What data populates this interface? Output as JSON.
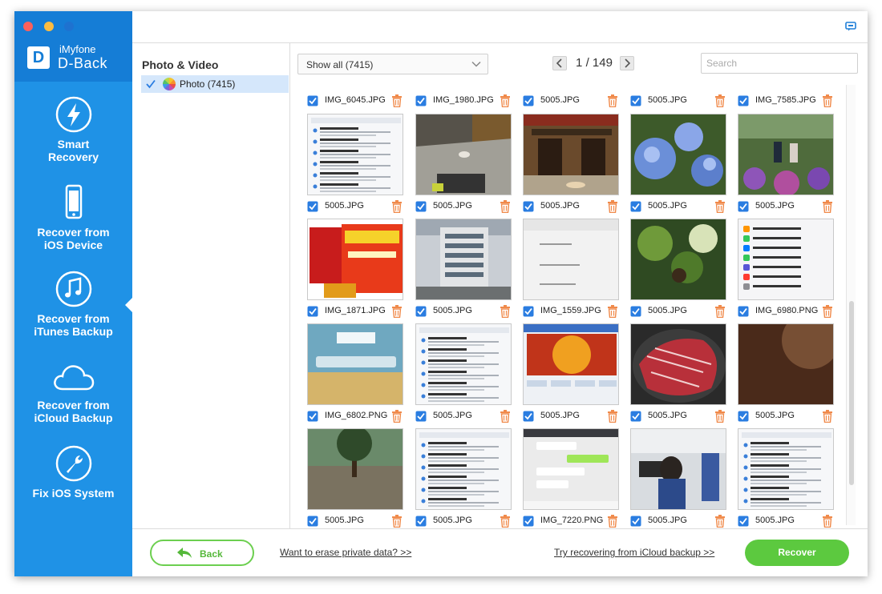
{
  "app": {
    "brand_small": "iMyfone",
    "brand_large": "D-Back",
    "logo_letter": "D"
  },
  "sidebar": {
    "items": [
      {
        "label_line1": "Smart",
        "label_line2": "Recovery",
        "icon": "lightning-icon"
      },
      {
        "label_line1": "Recover from",
        "label_line2": "iOS Device",
        "icon": "phone-icon"
      },
      {
        "label_line1": "Recover from",
        "label_line2": "iTunes Backup",
        "icon": "music-note-icon"
      },
      {
        "label_line1": "Recover from",
        "label_line2": "iCloud Backup",
        "icon": "cloud-icon"
      },
      {
        "label_line1": "Fix iOS System",
        "label_line2": "",
        "icon": "wrench-icon"
      }
    ],
    "active_index": 2
  },
  "category": {
    "title": "Photo & Video",
    "items": [
      {
        "label": "Photo (7415)",
        "checked": true
      }
    ]
  },
  "toolbar": {
    "filter_value": "Show all (7415)",
    "page_current": "1",
    "page_separator": "/",
    "page_total": "149",
    "search_placeholder": "Search"
  },
  "gallery": {
    "partial_row": [
      "IMG_6045.JPG",
      "IMG_1980.JPG",
      "5005.JPG",
      "5005.JPG",
      "IMG_7585.JPG"
    ],
    "rows": [
      [
        {
          "name": "5005.JPG",
          "thumb": "screenshot-list"
        },
        {
          "name": "5005.JPG",
          "thumb": "street-cat"
        },
        {
          "name": "5005.JPG",
          "thumb": "temple-dog"
        },
        {
          "name": "5005.JPG",
          "thumb": "hydrangea"
        },
        {
          "name": "5005.JPG",
          "thumb": "garden-people"
        }
      ],
      [
        {
          "name": "IMG_1871.JPG",
          "thumb": "red-ad"
        },
        {
          "name": "5005.JPG",
          "thumb": "building"
        },
        {
          "name": "IMG_1559.JPG",
          "thumb": "white-doc"
        },
        {
          "name": "5005.JPG",
          "thumb": "leaves"
        },
        {
          "name": "IMG_6980.PNG",
          "thumb": "settings-list"
        }
      ],
      [
        {
          "name": "IMG_6802.PNG",
          "thumb": "lockscreen"
        },
        {
          "name": "5005.JPG",
          "thumb": "screenshot-list"
        },
        {
          "name": "5005.JPG",
          "thumb": "sun-screen"
        },
        {
          "name": "5005.JPG",
          "thumb": "meat"
        },
        {
          "name": "5005.JPG",
          "thumb": "dark-brown"
        }
      ],
      [
        {
          "name": "5005.JPG",
          "thumb": "park"
        },
        {
          "name": "5005.JPG",
          "thumb": "screenshot-list"
        },
        {
          "name": "IMG_7220.PNG",
          "thumb": "chat"
        },
        {
          "name": "5005.JPG",
          "thumb": "office"
        },
        {
          "name": "5005.JPG",
          "thumb": "screenshot-list"
        }
      ]
    ]
  },
  "footer": {
    "back_label": "Back",
    "erase_link": "Want to erase private data? >>",
    "icloud_link": "Try recovering from iCloud backup >>",
    "recover_label": "Recover"
  },
  "colors": {
    "sidebar_bg": "#1f92e6",
    "sidebar_top": "#157dd6",
    "accent_green": "#5cc93f",
    "check_blue": "#2a7de1",
    "trash_orange": "#f08a4b"
  }
}
